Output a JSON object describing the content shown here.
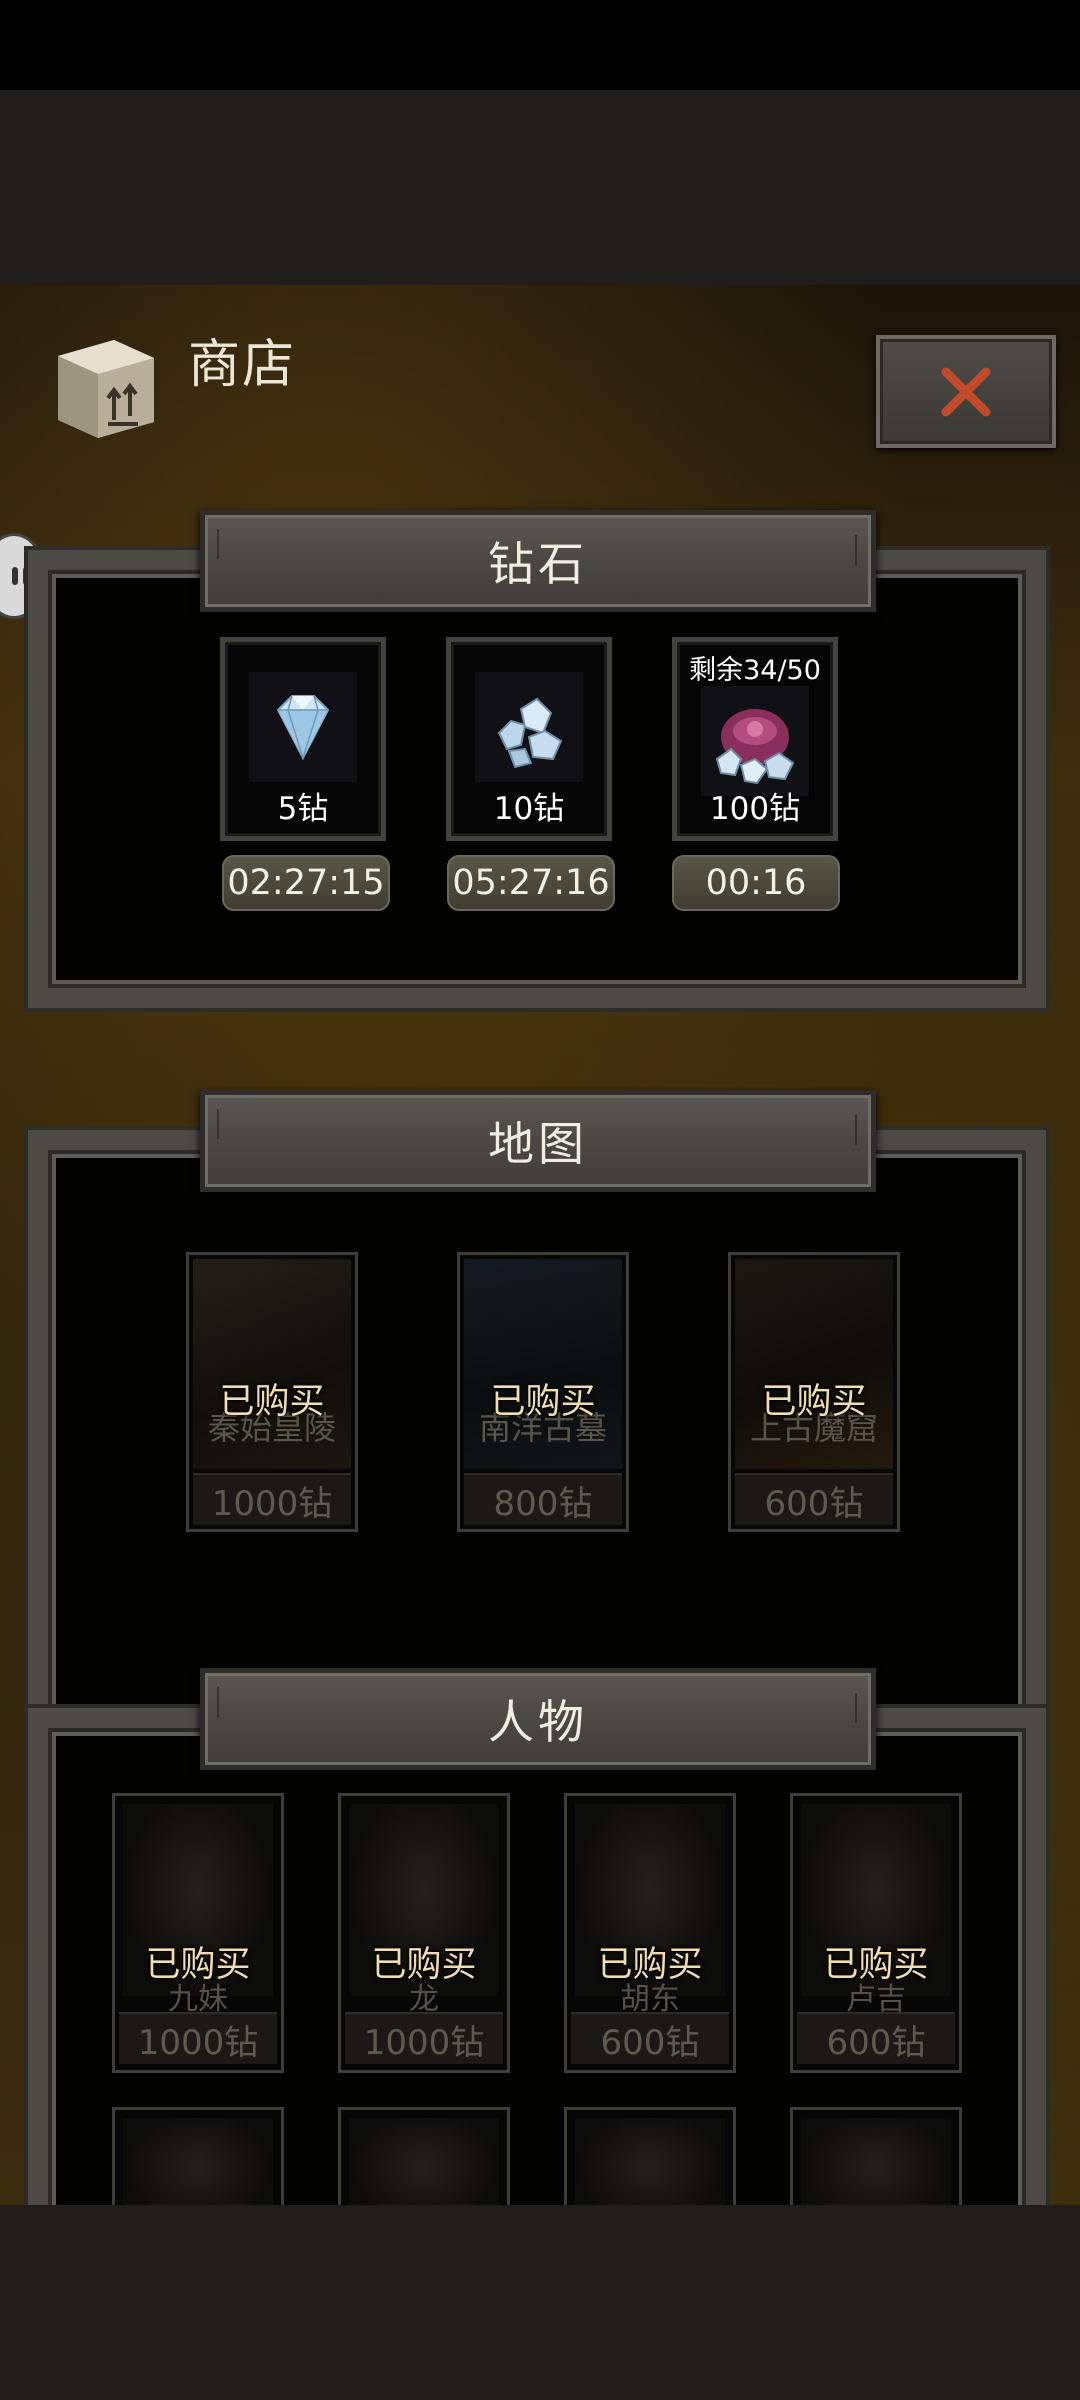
{
  "header": {
    "title": "商店",
    "icon": "crate-icon",
    "close_icon": "close-x-icon"
  },
  "diamond_section": {
    "title": "钻石",
    "items": [
      {
        "label": "5钻",
        "timer": "02:27:15",
        "icon": "diamond-small-icon",
        "remaining": ""
      },
      {
        "label": "10钻",
        "timer": "05:27:16",
        "icon": "diamond-pile-icon",
        "remaining": ""
      },
      {
        "label": "100钻",
        "timer": "00:16",
        "icon": "diamond-bag-icon",
        "remaining": "剩余34/50"
      }
    ]
  },
  "map_section": {
    "title": "地图",
    "items": [
      {
        "name": "秦始皇陵",
        "status": "已购买",
        "price": "1000钻"
      },
      {
        "name": "南洋古墓",
        "status": "已购买",
        "price": "800钻"
      },
      {
        "name": "上古魔窟",
        "status": "已购买",
        "price": "600钻"
      }
    ]
  },
  "character_section": {
    "title": "人物",
    "items": [
      {
        "name": "九妹",
        "status": "已购买",
        "price": "1000钻"
      },
      {
        "name": "龙",
        "status": "已购买",
        "price": "1000钻"
      },
      {
        "name": "胡东",
        "status": "已购买",
        "price": "600钻"
      },
      {
        "name": "卢吉",
        "status": "已购买",
        "price": "600钻"
      }
    ]
  },
  "colors": {
    "accent_gold": "#f0ddb0",
    "close_red": "#c04a2a",
    "frame_grey": "#4b4a45"
  }
}
